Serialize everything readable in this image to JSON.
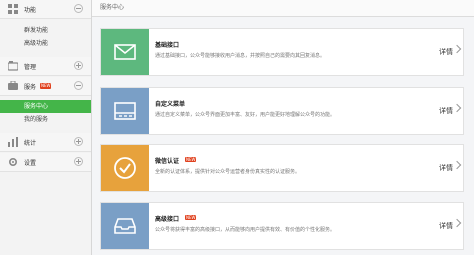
{
  "sidebar": {
    "groups": [
      {
        "label": "功能",
        "icon": "grid-icon",
        "toggle": "minus",
        "items": [
          {
            "label": "群发功能"
          },
          {
            "label": "高级功能"
          }
        ]
      },
      {
        "label": "管理",
        "icon": "folder-icon",
        "toggle": "plus",
        "items": []
      },
      {
        "label": "服务",
        "icon": "service-icon",
        "toggle": "minus",
        "badge": "NEW",
        "items": [
          {
            "label": "服务中心",
            "active": true
          },
          {
            "label": "我的服务"
          }
        ]
      },
      {
        "label": "统计",
        "icon": "chart-icon",
        "toggle": "plus",
        "items": []
      },
      {
        "label": "设置",
        "icon": "gear-icon",
        "toggle": "plus",
        "items": []
      }
    ]
  },
  "breadcrumb": "服务中心",
  "cards": [
    {
      "title": "基础接口",
      "desc": "通过基础接口，公众号能够接收用户消息，并按照自己的需要向其回复消息。",
      "more": "详情",
      "color": "#5db87e",
      "icon": "mail-icon"
    },
    {
      "title": "自定义菜单",
      "desc": "通过自定义菜单，公众号界面更加丰富、友好，用户能更好地理解公众号的功能。",
      "more": "详情",
      "color": "#7a9fc6",
      "icon": "menu-icon"
    },
    {
      "title": "微信认证",
      "badge": "NEW",
      "desc": "全新的认证体系，提供针对公众号运营者身份真实性的认证服务。",
      "more": "详情",
      "color": "#e7a23c",
      "icon": "check-icon"
    },
    {
      "title": "高级接口",
      "badge": "NEW",
      "desc": "公众号将获得丰富的高级接口，从而能够向用户提供有效、有价值的个性化服务。",
      "more": "详情",
      "color": "#7a9fc6",
      "icon": "tray-icon"
    }
  ]
}
